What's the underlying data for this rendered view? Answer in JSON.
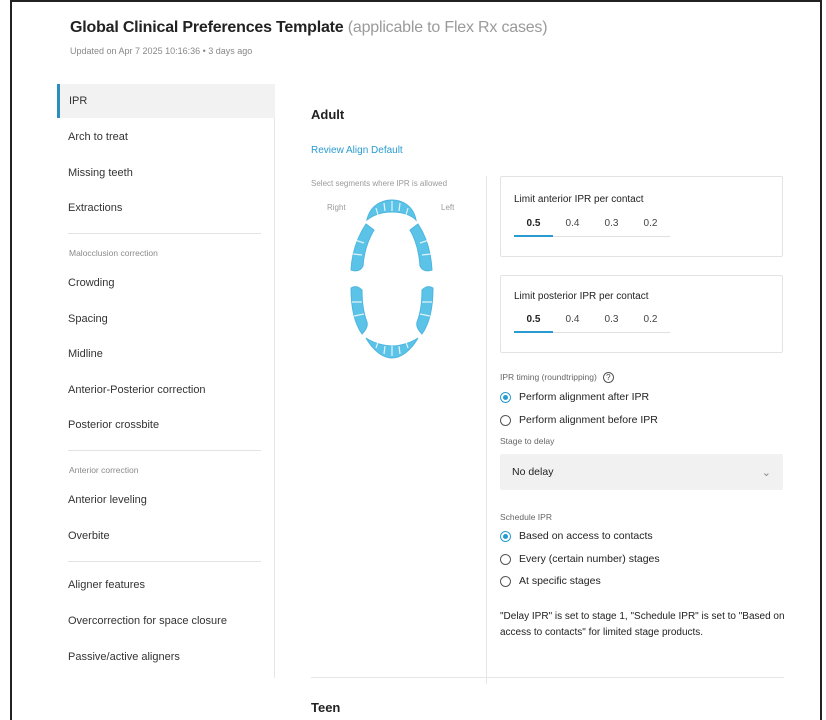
{
  "header": {
    "title": "Global Clinical Preferences Template",
    "subtitle": "(applicable to Flex Rx cases)",
    "updated": "Updated on Apr 7 2025 10:16:36 • 3 days ago"
  },
  "sidebar": {
    "items": [
      {
        "label": "IPR",
        "active": true
      },
      {
        "label": "Arch to treat"
      },
      {
        "label": "Missing teeth"
      },
      {
        "label": "Extractions"
      },
      {
        "label": "Crowding"
      },
      {
        "label": "Spacing"
      },
      {
        "label": "Midline"
      },
      {
        "label": "Anterior-Posterior correction"
      },
      {
        "label": "Posterior crossbite"
      },
      {
        "label": "Anterior leveling"
      },
      {
        "label": "Overbite"
      },
      {
        "label": "Aligner features"
      },
      {
        "label": "Overcorrection for space closure"
      },
      {
        "label": "Passive/active aligners"
      }
    ],
    "groups": [
      "Malocclusion correction",
      "Anterior correction"
    ]
  },
  "main": {
    "section_adult": "Adult",
    "review_link": "Review Align Default",
    "select_hint": "Select segments where IPR is allowed",
    "arch_right": "Right",
    "arch_left": "Left",
    "anterior_card": {
      "title": "Limit anterior IPR per contact",
      "options": [
        "0.5",
        "0.4",
        "0.3",
        "0.2"
      ],
      "selected": "0.5"
    },
    "posterior_card": {
      "title": "Limit posterior IPR per contact",
      "options": [
        "0.5",
        "0.4",
        "0.3",
        "0.2"
      ],
      "selected": "0.5"
    },
    "ipr_timing": {
      "label": "IPR timing (roundtripping)",
      "help_icon": "?",
      "options": [
        "Perform alignment after IPR",
        "Perform alignment before IPR"
      ],
      "selected": "Perform alignment after IPR"
    },
    "stage_to_delay": {
      "label": "Stage to delay",
      "value": "No delay"
    },
    "schedule_ipr": {
      "label": "Schedule IPR",
      "options": [
        "Based on access to contacts",
        "Every (certain number) stages",
        "At specific stages"
      ],
      "selected": "Based on access to contacts"
    },
    "note": "\"Delay IPR\" is set to stage 1, \"Schedule IPR\" is set to \"Based on access to contacts\" for limited stage products.",
    "section_teen": "Teen"
  },
  "colors": {
    "accent": "#2a9bd0",
    "teeth": "#5cc3e8",
    "active_bg": "#f2f2f2"
  }
}
